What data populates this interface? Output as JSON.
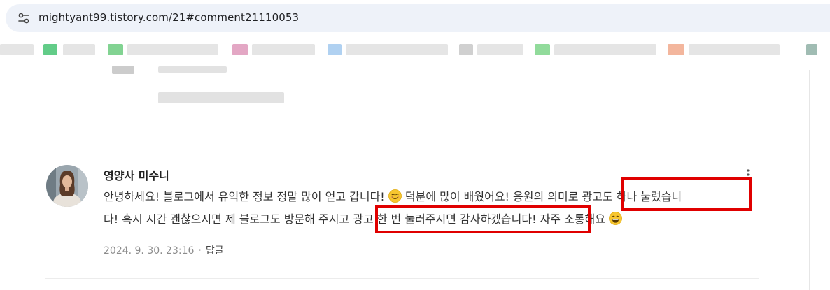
{
  "browser": {
    "url": "mightyant99.tistory.com/21#comment21110053",
    "site_info_icon": "tune-icon"
  },
  "comment": {
    "author": "영양사 미수니",
    "avatar_icon": "user-avatar",
    "more_icon": "vertical-dots-icon",
    "line1_before_emoji": "안녕하세요! 블로그에서 유익한 정보 정말 많이 얻고 갑니다!",
    "line1_after_emoji": " 덕분에 많이 배웠어요! 응원의 의미로 광고도 하나 눌렀습니",
    "line2_before_emoji": "다! 혹시 시간 괜찮으시면 제 블로그도 방문해 주시고 광고 한 번 눌러주시면 감사하겠습니다! 자주 소통해요 ",
    "emoji_1": "smiling-face-emoji",
    "emoji_2": "grinning-face-emoji",
    "date": "2024. 9. 30. 23:16",
    "separator": "·",
    "reply_label": "답글"
  },
  "highlight_color": "#e00000"
}
